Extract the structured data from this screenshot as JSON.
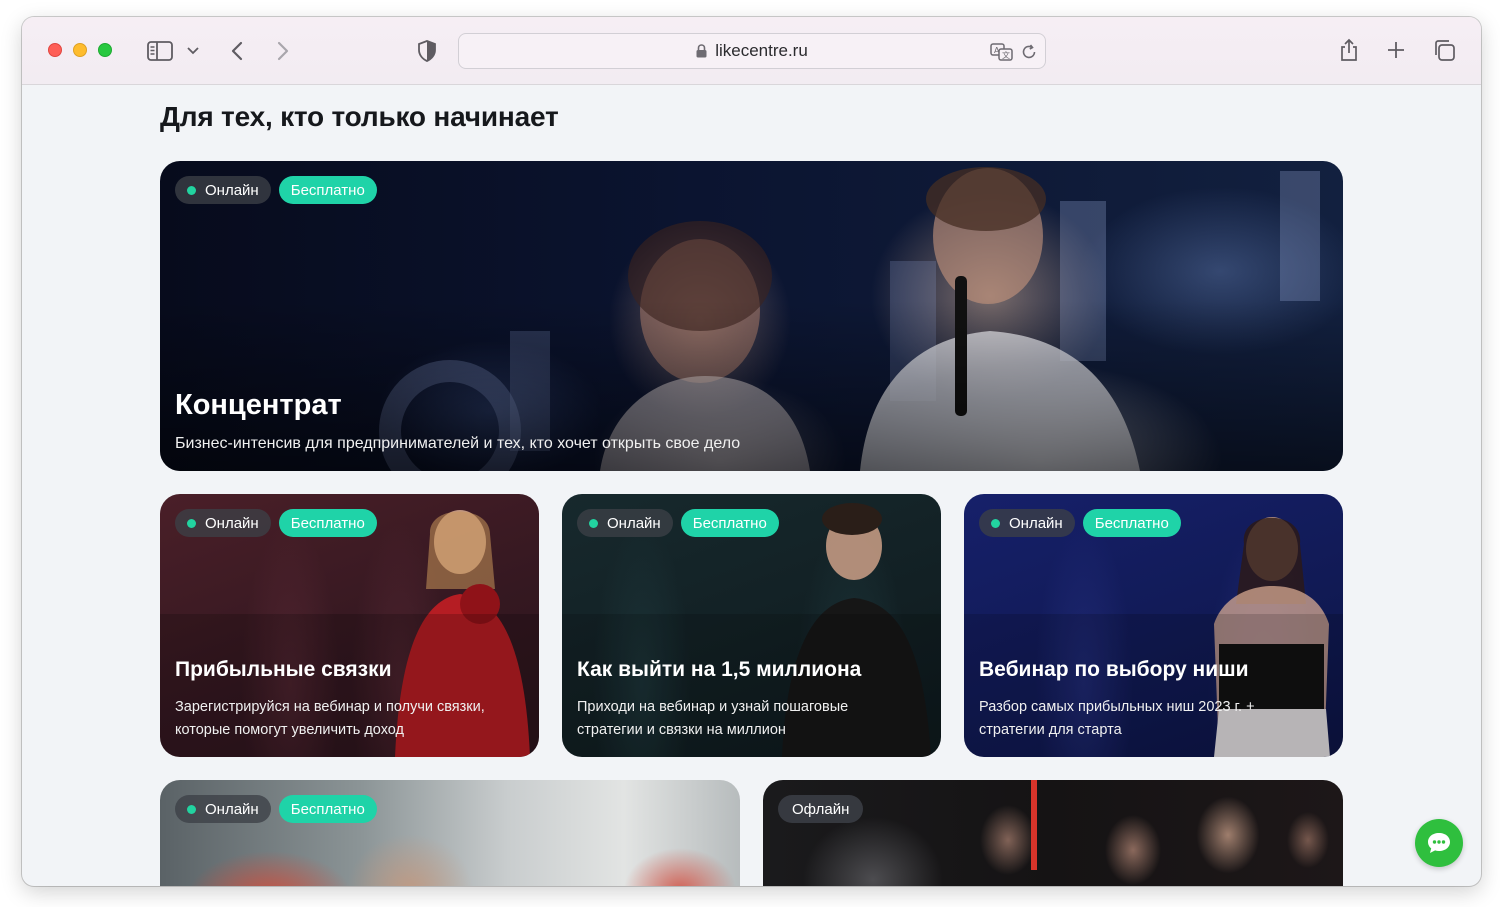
{
  "browser": {
    "url": "likecentre.ru"
  },
  "page": {
    "heading": "Для тех, кто только начинает"
  },
  "badges": {
    "online": "Онлайн",
    "free": "Бесплатно",
    "offline": "Офлайн"
  },
  "cards": [
    {
      "title": "Концентрат",
      "description": "Бизнес-интенсив для предпринимателей и тех, кто хочет открыть свое дело"
    },
    {
      "title": "Прибыльные связки",
      "description": "Зарегистрируйся на вебинар и получи связки, которые помогут увеличить доход"
    },
    {
      "title": "Как выйти на 1,5 миллиона",
      "description": "Приходи на вебинар и узнай пошаговые стратегии и связки на миллион"
    },
    {
      "title": "Вебинар по выбору ниши",
      "description": "Разбор самых прибыльных ниш 2023 г. + стратегии для старта"
    }
  ],
  "colors": {
    "accent": "#1fd3a8",
    "chat_button": "#2fbf3e"
  }
}
